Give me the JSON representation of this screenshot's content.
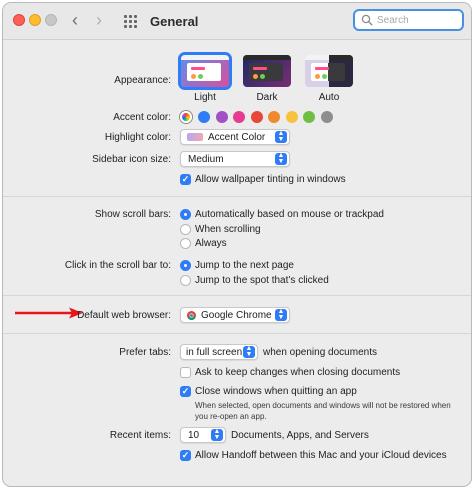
{
  "window": {
    "title": "General",
    "search": {
      "placeholder": "Search",
      "value": ""
    }
  },
  "appearance": {
    "label": "Appearance:",
    "options": [
      {
        "label": "Light",
        "selected": true
      },
      {
        "label": "Dark",
        "selected": false
      },
      {
        "label": "Auto",
        "selected": false
      }
    ]
  },
  "accent_color": {
    "label": "Accent color:",
    "swatches": [
      "#multicolor",
      "#2e7cf6",
      "#a052c4",
      "#e63c8f",
      "#e9463a",
      "#f0892d",
      "#f7c33c",
      "#6dbf43",
      "#8e8e8e"
    ],
    "selected_index": 0
  },
  "highlight_color": {
    "label": "Highlight color:",
    "value": "Accent Color"
  },
  "sidebar_icon_size": {
    "label": "Sidebar icon size:",
    "value": "Medium"
  },
  "wallpaper_tinting": {
    "label": "Allow wallpaper tinting in windows",
    "checked": true
  },
  "scroll_bars": {
    "label": "Show scroll bars:",
    "options": [
      {
        "label": "Automatically based on mouse or trackpad",
        "selected": true
      },
      {
        "label": "When scrolling",
        "selected": false
      },
      {
        "label": "Always",
        "selected": false
      }
    ]
  },
  "click_scroll": {
    "label": "Click in the scroll bar to:",
    "options": [
      {
        "label": "Jump to the next page",
        "selected": true
      },
      {
        "label": "Jump to the spot that’s clicked",
        "selected": false
      }
    ]
  },
  "default_browser": {
    "label": "Default web browser:",
    "value": "Google Chrome"
  },
  "prefer_tabs": {
    "label": "Prefer tabs:",
    "value": "in full screen",
    "suffix": "when opening documents"
  },
  "ask_keep_changes": {
    "label": "Ask to keep changes when closing documents",
    "checked": false
  },
  "close_windows": {
    "label": "Close windows when quitting an app",
    "checked": true,
    "helper": "When selected, open documents and windows will not be restored when you re-open an app."
  },
  "recent_items": {
    "label": "Recent items:",
    "value": "10",
    "suffix": "Documents, Apps, and Servers"
  },
  "handoff": {
    "label": "Allow Handoff between this Mac and your iCloud devices",
    "checked": true
  },
  "colors": {
    "accent": "#2e7cf6",
    "annotation_arrow": "#e8161b"
  },
  "icons": [
    "back-chevron-icon",
    "forward-chevron-icon",
    "grid-icon",
    "search-icon",
    "chrome-icon",
    "red-arrow-icon"
  ]
}
